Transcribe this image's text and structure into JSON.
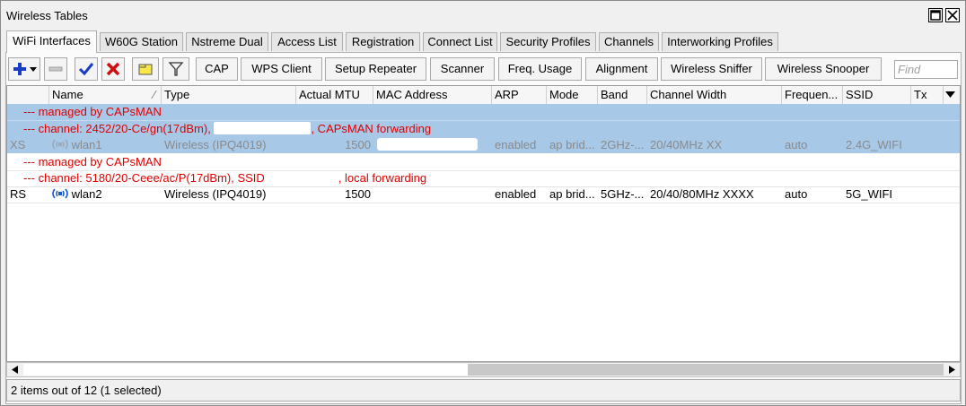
{
  "window": {
    "title": "Wireless Tables"
  },
  "tabs": [
    "WiFi Interfaces",
    "W60G Station",
    "Nstreme Dual",
    "Access List",
    "Registration",
    "Connect List",
    "Security Profiles",
    "Channels",
    "Interworking Profiles"
  ],
  "toolbar": {
    "cap": "CAP",
    "wps_client": "WPS Client",
    "setup_repeater": "Setup Repeater",
    "scanner": "Scanner",
    "freq_usage": "Freq. Usage",
    "alignment": "Alignment",
    "wireless_sniffer": "Wireless Sniffer",
    "wireless_snooper": "Wireless Snooper",
    "find_placeholder": "Find"
  },
  "columns": [
    "Name",
    "Type",
    "Actual MTU",
    "MAC Address",
    "ARP",
    "Mode",
    "Band",
    "Channel Width",
    "Frequen...",
    "SSID",
    "Tx"
  ],
  "rows": [
    {
      "comment1": "--- managed by CAPsMAN",
      "comment2a": "--- channel: 2452/20-Ce/gn(17dBm), ",
      "comment2b": ", CAPsMAN forwarding",
      "flags": "XS",
      "name": "wlan1",
      "type": "Wireless (IPQ4019)",
      "mtu": "1500",
      "mac": "",
      "arp": "enabled",
      "mode": "ap brid...",
      "band": "2GHz-...",
      "width": "20/40MHz XX",
      "freq": "auto",
      "ssid": "2.4G_WIFI"
    },
    {
      "comment1": "--- managed by CAPsMAN",
      "comment2a": "--- channel: 5180/20-Ceee/ac/P(17dBm), SSID",
      "comment2b": ", local forwarding",
      "flags": "RS",
      "name": "wlan2",
      "type": "Wireless (IPQ4019)",
      "mtu": "1500",
      "mac": "",
      "arp": "enabled",
      "mode": "ap brid...",
      "band": "5GHz-...",
      "width": "20/40/80MHz XXXX",
      "freq": "auto",
      "ssid": "5G_WIFI"
    }
  ],
  "status": "2 items out of 12 (1 selected)",
  "colors": {
    "selected_row": "#a8c8e8",
    "comment_text": "#e00000",
    "add_icon": "#1a3cc8",
    "remove_icon": "#d01010"
  }
}
